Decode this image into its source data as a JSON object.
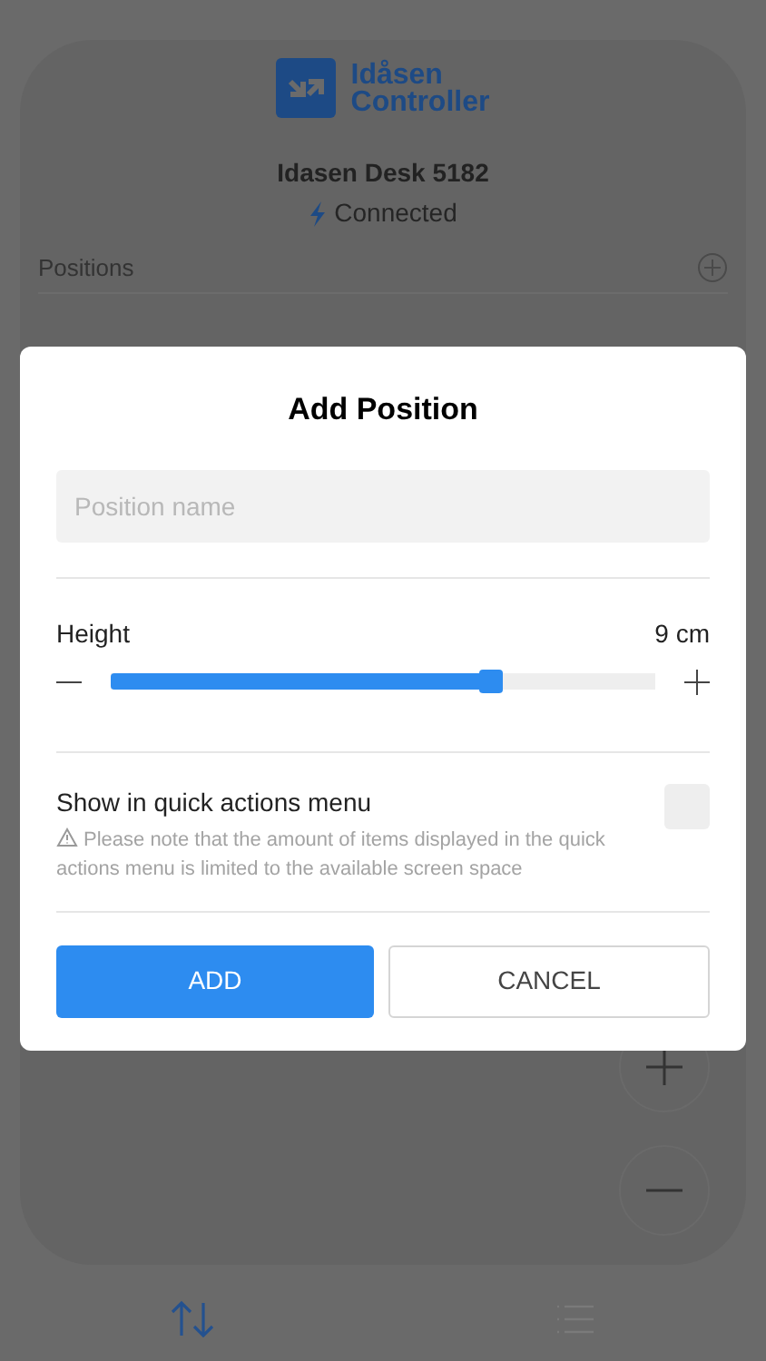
{
  "logo": {
    "line_1": "Idåsen",
    "line_2": "Controller"
  },
  "device": {
    "name": "Idasen Desk 5182",
    "status": "Connected",
    "connected": true
  },
  "positions": {
    "title": "Positions"
  },
  "tabs": [
    {
      "kind": "move",
      "selected": true
    },
    {
      "kind": "list",
      "selected": false
    }
  ],
  "dialog": {
    "title": "Add Position",
    "name_field": {
      "placeholder": "Position name"
    },
    "height": {
      "label": "Height",
      "reading": "9 cm",
      "level": 0.7
    },
    "quick_actions": {
      "label": "Show in quick actions menu",
      "note": "Please note that the amount of items displayed in the quick actions menu is limited to the available screen space",
      "checked": false
    },
    "buttons": [
      {
        "kind": "primary",
        "label": "ADD"
      },
      {
        "kind": "secondary",
        "label": "CANCEL"
      }
    ]
  }
}
